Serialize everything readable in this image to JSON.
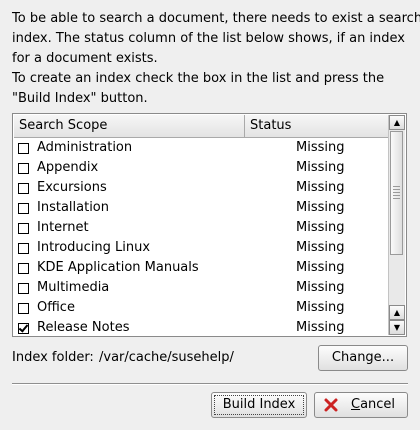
{
  "intro": {
    "line1": "To be able to search a document, there needs to exist a search",
    "line2": "index. The status column of the list below shows, if an index",
    "line3": "for a document exists.",
    "line4": "To create an index check the box in the list and press the",
    "line5": "\"Build Index\" button."
  },
  "list": {
    "header_scope": "Search Scope",
    "header_status": "Status",
    "items": [
      {
        "name": "Administration",
        "status": "Missing",
        "checked": false
      },
      {
        "name": "Appendix",
        "status": "Missing",
        "checked": false
      },
      {
        "name": "Excursions",
        "status": "Missing",
        "checked": false
      },
      {
        "name": "Installation",
        "status": "Missing",
        "checked": false
      },
      {
        "name": "Internet",
        "status": "Missing",
        "checked": false
      },
      {
        "name": "Introducing Linux",
        "status": "Missing",
        "checked": false
      },
      {
        "name": "KDE Application Manuals",
        "status": "Missing",
        "checked": false
      },
      {
        "name": "Multimedia",
        "status": "Missing",
        "checked": false
      },
      {
        "name": "Office",
        "status": "Missing",
        "checked": false
      },
      {
        "name": "Release Notes",
        "status": "Missing",
        "checked": true
      }
    ]
  },
  "folder": {
    "label": "Index folder:",
    "path": "/var/cache/susehelp/"
  },
  "buttons": {
    "change": "Change...",
    "build": "Build Index",
    "cancel": "Cancel"
  },
  "icons": {
    "cancel": "x-icon",
    "scroll_up": "arrow-up-icon",
    "scroll_down": "arrow-down-icon"
  },
  "colors": {
    "cancel_x": "#cc2222"
  }
}
